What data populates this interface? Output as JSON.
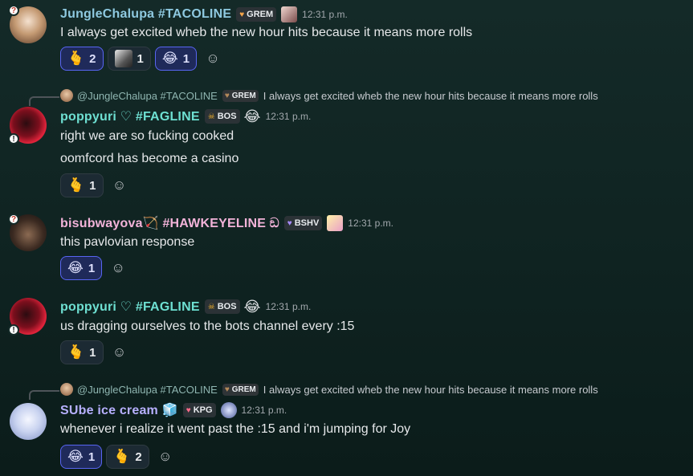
{
  "messages": [
    {
      "username": "JungleChalupa #TACOLINE",
      "tag": "GREM",
      "time": "12:31 p.m.",
      "text": "I always get excited wheb the new hour hits because it means more rolls",
      "reactions": [
        {
          "emoji": "🫰",
          "count": "2",
          "me": true
        },
        {
          "emoji": "image",
          "count": "1",
          "me": false
        },
        {
          "emoji": "😂",
          "count": "1",
          "me": true
        }
      ]
    },
    {
      "reply": {
        "username": "@JungleChalupa #TACOLINE",
        "tag": "GREM",
        "text": "I always get excited wheb the new hour hits because it means more rolls"
      },
      "username": "poppyuri ♡ #FAGLINE",
      "tag": "BOS",
      "time": "12:31 p.m.",
      "lines": [
        "right we are so fucking cooked",
        "oomfcord has become a casino"
      ],
      "reactions": [
        {
          "emoji": "🫰",
          "count": "1",
          "me": false
        }
      ]
    },
    {
      "username": "bisubwayova🏹 #HAWKEYELINE ඞ",
      "tag": "BSHV",
      "time": "12:31 p.m.",
      "text": "this pavlovian response",
      "reactions": [
        {
          "emoji": "😂",
          "count": "1",
          "me": true
        }
      ]
    },
    {
      "username": "poppyuri ♡ #FAGLINE",
      "tag": "BOS",
      "time": "12:31 p.m.",
      "text": "us dragging ourselves to the bots channel every :15",
      "reactions": [
        {
          "emoji": "🫰",
          "count": "1",
          "me": false
        }
      ]
    },
    {
      "reply": {
        "username": "@JungleChalupa #TACOLINE",
        "tag": "GREM",
        "text": "I always get excited wheb the new hour hits because it means more rolls"
      },
      "username": "SUbe ice cream 🧊",
      "tag": "KPG",
      "time": "12:31 p.m.",
      "text": "whenever i realize it went past the :15 and i'm jumping for Joy",
      "reactions": [
        {
          "emoji": "😂",
          "count": "1",
          "me": true
        },
        {
          "emoji": "🫰",
          "count": "2",
          "me": false
        }
      ]
    }
  ],
  "icons": {
    "add_reaction": "smiley-add-icon",
    "tag_heart": "heart-icon",
    "tag_skull": "skull-icon"
  },
  "colors": {
    "name_jungle": "#8ec9e0",
    "name_poppy": "#6ee0d2",
    "name_bisub": "#f2b3d9",
    "name_sube": "#b7b0ff",
    "reaction_selected": "#5865f2"
  }
}
